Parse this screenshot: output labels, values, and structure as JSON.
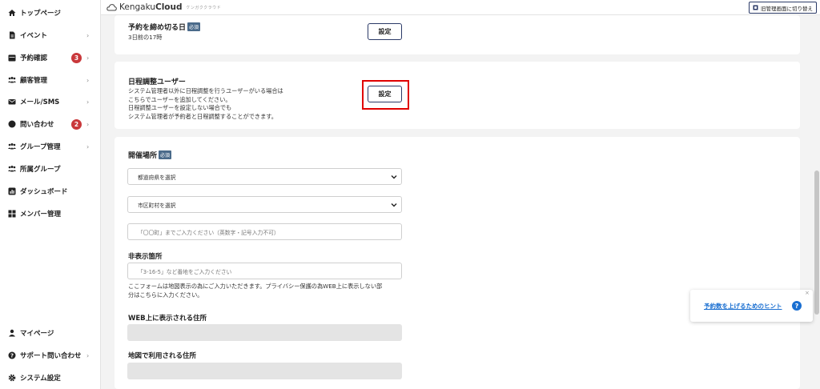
{
  "header": {
    "logo_text_regular": "Kengaku",
    "logo_text_bold": "Cloud",
    "logo_sub": "ケンガククラウド",
    "switch_button": "旧管理画面に切り替え"
  },
  "sidebar": {
    "items": [
      {
        "label": "トップページ",
        "icon": "home-icon"
      },
      {
        "label": "イベント",
        "icon": "document-icon"
      },
      {
        "label": "予約確認",
        "icon": "calendar-icon",
        "badge": "3"
      },
      {
        "label": "顧客管理",
        "icon": "people-icon"
      },
      {
        "label": "メール/SMS",
        "icon": "mail-icon"
      },
      {
        "label": "問い合わせ",
        "icon": "chat-icon",
        "badge": "2"
      },
      {
        "label": "グループ管理",
        "icon": "group-icon"
      },
      {
        "label": "所属グループ",
        "icon": "group-member-icon"
      },
      {
        "label": "ダッシュボード",
        "icon": "dashboard-icon"
      },
      {
        "label": "メンバー管理",
        "icon": "grid-icon"
      }
    ],
    "bottom_items": [
      {
        "label": "マイページ",
        "icon": "user-icon"
      },
      {
        "label": "サポート問い合わせ",
        "icon": "help-icon"
      },
      {
        "label": "システム設定",
        "icon": "gear-icon"
      }
    ],
    "chevron": "›"
  },
  "deadline": {
    "title": "予約を締め切る日",
    "required": "必須",
    "value": "3日前の17時",
    "button": "設定"
  },
  "schedule_user": {
    "title": "日程調整ユーザー",
    "lines": [
      "システム管理者以外に日程調整を行うユーザーがいる場合は",
      "こちらでユーザーを追加してください。",
      "日程調整ユーザーを設定しない場合でも",
      "システム管理者が予約者と日程調整することができます。"
    ],
    "button": "設定"
  },
  "venue": {
    "title": "開催場所",
    "required": "必須",
    "prefecture_select": "都道府県を選択",
    "city_select": "市区町村を選択",
    "town_placeholder": "「〇〇町」までご入力ください（英数字・記号入力不可）",
    "hidden_label": "非表示箇所",
    "hidden_placeholder": "「3-16-5」など番地をご入力ください",
    "note_line1": "ここフォームは地図表示の為にご入力いただきます。プライバシー保護の為WEB上に表示しない部",
    "note_line2": "分はこちらに入力ください。",
    "web_address_label": "WEB上に表示される住所",
    "map_address_label": "地図で利用される住所"
  },
  "hint": {
    "link": "予約数を上げるためのヒント",
    "question": "?",
    "close": "×"
  },
  "colors": {
    "badge": "#c9383b",
    "navy": "#2b3a67",
    "highlight": "#e00000",
    "link": "#1a6fd1"
  }
}
